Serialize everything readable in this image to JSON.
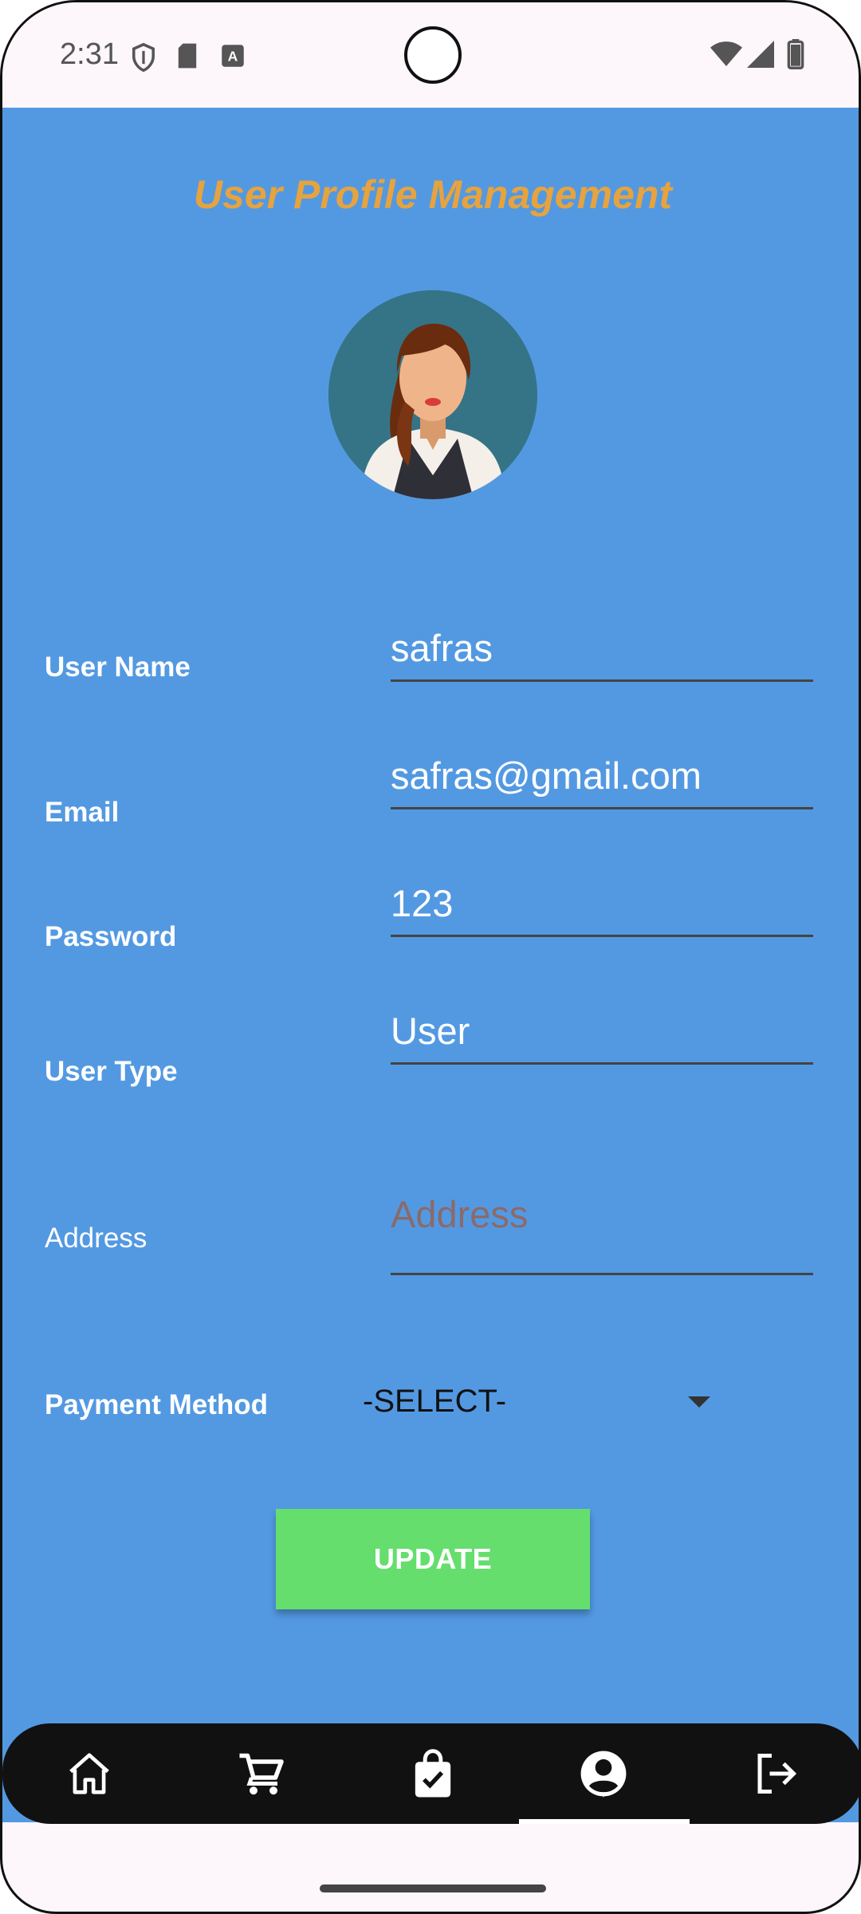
{
  "status_bar": {
    "time": "2:31"
  },
  "page": {
    "title": "User Profile Management"
  },
  "form": {
    "username": {
      "label": "User Name",
      "value": "safras"
    },
    "email": {
      "label": "Email",
      "value": "safras@gmail.com"
    },
    "password": {
      "label": "Password",
      "value": "123"
    },
    "user_type": {
      "label": "User Type",
      "value": "User"
    },
    "address": {
      "label": "Address",
      "value": "",
      "placeholder": "Address"
    },
    "payment_method": {
      "label": "Payment Method",
      "selected": "-SELECT-"
    }
  },
  "actions": {
    "update_label": "UPDATE"
  },
  "bottom_nav": {
    "items": [
      {
        "icon": "home-icon"
      },
      {
        "icon": "cart-icon"
      },
      {
        "icon": "shopping-bag-check-icon"
      },
      {
        "icon": "account-circle-icon",
        "active": true
      },
      {
        "icon": "logout-icon"
      }
    ]
  },
  "colors": {
    "background": "#5399e2",
    "title": "#e6a33e",
    "button": "#65de6e",
    "nav": "#111111"
  }
}
